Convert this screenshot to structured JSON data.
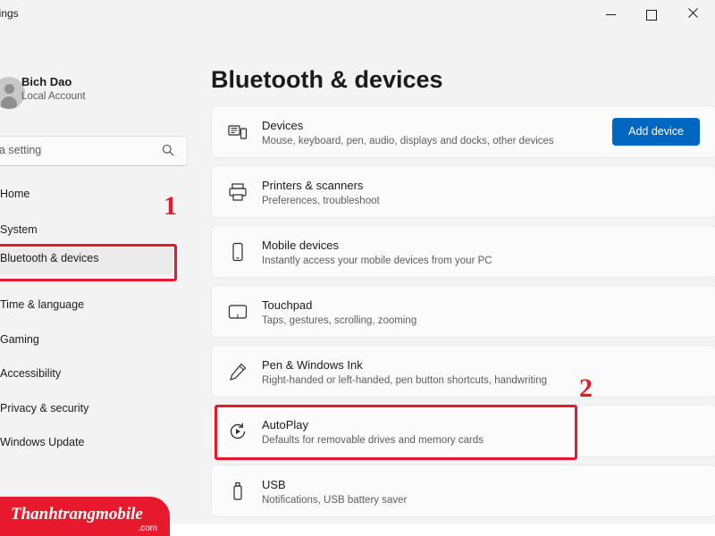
{
  "window": {
    "title": "ttings",
    "minimize_label": "minimize",
    "maximize_label": "maximize",
    "close_label": "close"
  },
  "account": {
    "name": "Bich Dao",
    "type": "Local Account"
  },
  "search": {
    "value": "a setting",
    "icon": "search-icon"
  },
  "nav": {
    "items": [
      {
        "label": "Home",
        "selected": false
      },
      {
        "label": "System",
        "selected": false
      },
      {
        "label": "Bluetooth & devices",
        "selected": true
      },
      {
        "label": "Time & language",
        "selected": false
      },
      {
        "label": "Gaming",
        "selected": false
      },
      {
        "label": "Accessibility",
        "selected": false
      },
      {
        "label": "Privacy & security",
        "selected": false
      },
      {
        "label": "Windows Update",
        "selected": false
      }
    ]
  },
  "page": {
    "title": "Bluetooth & devices",
    "add_device_label": "Add device"
  },
  "cards": [
    {
      "icon": "devices-icon",
      "title": "Devices",
      "subtitle": "Mouse, keyboard, pen, audio, displays and docks, other devices"
    },
    {
      "icon": "printer-icon",
      "title": "Printers & scanners",
      "subtitle": "Preferences, troubleshoot"
    },
    {
      "icon": "phone-icon",
      "title": "Mobile devices",
      "subtitle": "Instantly access your mobile devices from your PC"
    },
    {
      "icon": "touchpad-icon",
      "title": "Touchpad",
      "subtitle": "Taps, gestures, scrolling, zooming"
    },
    {
      "icon": "pen-icon",
      "title": "Pen & Windows Ink",
      "subtitle": "Right-handed or left-handed, pen button shortcuts, handwriting"
    },
    {
      "icon": "autoplay-icon",
      "title": "AutoPlay",
      "subtitle": "Defaults for removable drives and memory cards"
    },
    {
      "icon": "usb-icon",
      "title": "USB",
      "subtitle": "Notifications, USB battery saver"
    }
  ],
  "annotations": {
    "step_one": "1",
    "step_two": "2",
    "color": "#e8192c"
  },
  "watermark": {
    "brand": "Thanhtrangmobile",
    "suffix": ".com"
  }
}
